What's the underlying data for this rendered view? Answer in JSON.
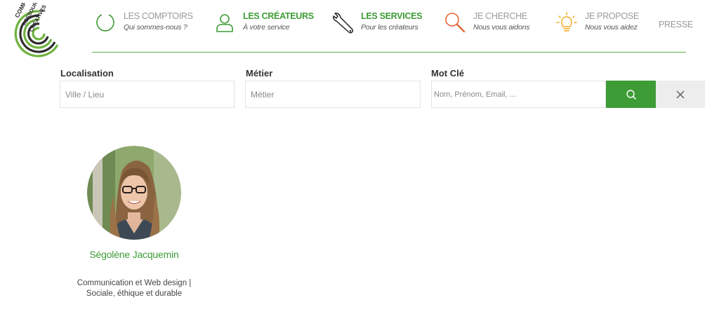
{
  "logo": {
    "lines": [
      "COMPTOIR",
      "des",
      "RESSOURCES",
      "CRÉATIVES"
    ],
    "colors": {
      "green": "#6db33f",
      "dark": "#2d2d2d"
    }
  },
  "nav": {
    "items": [
      {
        "title": "LES COMPTOIRS",
        "subtitle": "Qui sommes-nous ?",
        "icon": "circle-icon",
        "active": false
      },
      {
        "title": "LES CRÉATEURS",
        "subtitle": "À votre service",
        "icon": "user-icon",
        "active": true
      },
      {
        "title": "LES SERVICES",
        "subtitle": "Pour les créateurs",
        "icon": "wrench-icon",
        "active": true
      },
      {
        "title": "JE CHERCHE",
        "subtitle": "Nous vous aidons",
        "icon": "magnifier-icon",
        "active": false
      },
      {
        "title": "JE PROPOSE",
        "subtitle": "Nous vous aidez",
        "icon": "lightbulb-icon",
        "active": false
      },
      {
        "title": "PRESSE",
        "subtitle": "",
        "icon": "",
        "active": false
      }
    ]
  },
  "search": {
    "location": {
      "label": "Localisation",
      "placeholder": "Ville / Lieu",
      "value": ""
    },
    "job": {
      "label": "Métier",
      "placeholder": "Métier",
      "value": ""
    },
    "keyword": {
      "label": "Mot Clé",
      "placeholder": "Nom, Prénom, Email, ...",
      "value": ""
    }
  },
  "results": [
    {
      "name": "Ségolène Jacquemin",
      "description": "Communication et Web design | Sociale, éthique et durable"
    }
  ],
  "colors": {
    "accent": "#3d9c36",
    "nav_inactive": "#9a9a9a",
    "icon_orange": "#e2673a",
    "icon_yellow": "#f0a81e",
    "clear_bg": "#ededed"
  }
}
